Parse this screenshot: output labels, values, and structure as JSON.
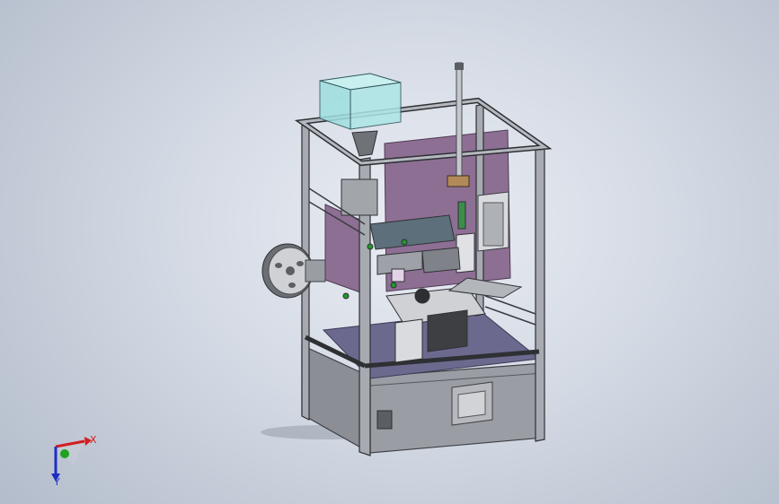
{
  "viewport": {
    "background_top": "#e9edf4",
    "background_bottom": "#b3bccb"
  },
  "model": {
    "frame_color": "#8a8f96",
    "panel_color": "#8e6f94",
    "base_color": "#8d9097",
    "deck_color": "#6b6a8e",
    "glass_color": "#9fe0e0"
  },
  "triad": {
    "x_label": "X",
    "y_label": "Y",
    "x_color": "#d21e1e",
    "y_color": "#1c2fc4",
    "z_color": "#1fa31f"
  }
}
